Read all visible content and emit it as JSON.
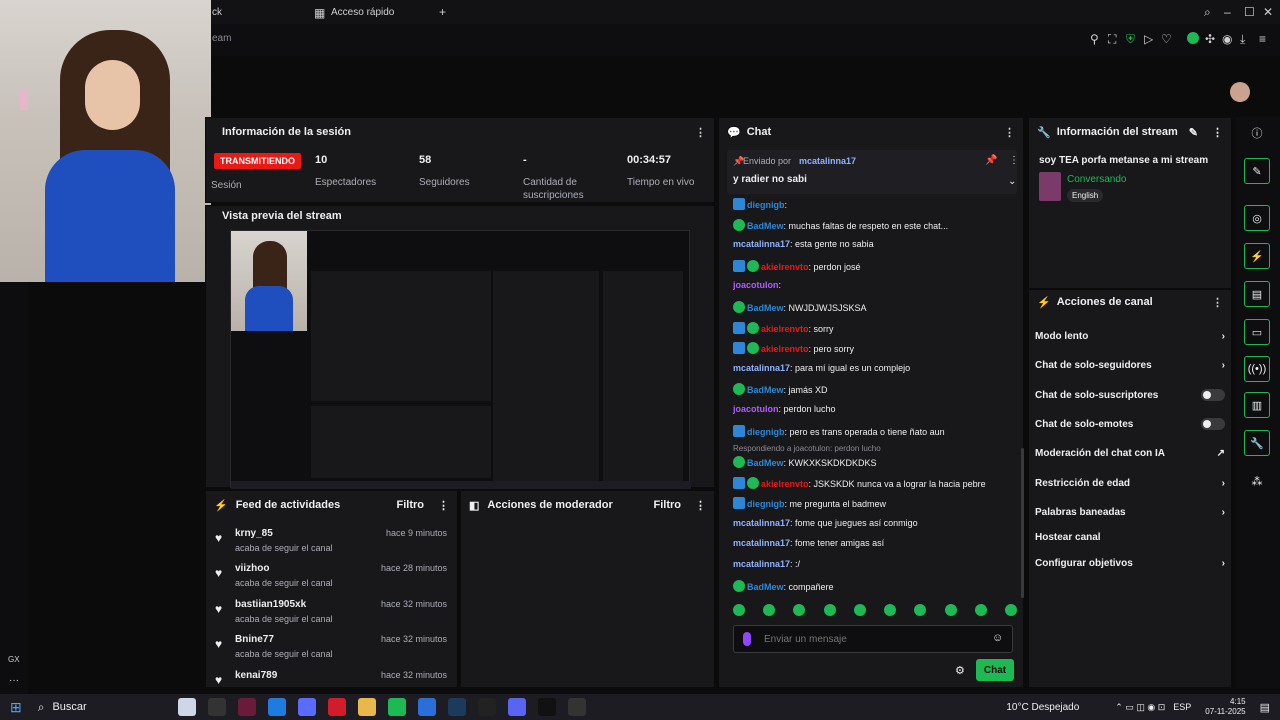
{
  "browser": {
    "tab_partial": "ck",
    "quick_access_tab": "Acceso rápido",
    "address_partial": "eam"
  },
  "gx": {
    "label": "GX"
  },
  "session": {
    "title": "Información de la sesión",
    "live_badge": "TRANSMITIENDO",
    "session_label": "Sesión",
    "viewers_value": "10",
    "viewers_label": "Espectadores",
    "followers_value": "58",
    "followers_label": "Seguidores",
    "subs_value": "-",
    "subs_label": "Cantidad de suscripciones",
    "uptime_value": "00:34:57",
    "uptime_label": "Tiempo en vivo"
  },
  "preview": {
    "title": "Vista previa del stream"
  },
  "feed": {
    "title": "Feed de actividades",
    "filter": "Filtro",
    "items": [
      {
        "name": "krny_85",
        "desc": "acaba de seguir el canal",
        "time": "hace 9 minutos"
      },
      {
        "name": "viizhoo",
        "desc": "acaba de seguir el canal",
        "time": "hace 28 minutos"
      },
      {
        "name": "bastiian1905xk",
        "desc": "acaba de seguir el canal",
        "time": "hace 32 minutos"
      },
      {
        "name": "Bnine77",
        "desc": "acaba de seguir el canal",
        "time": "hace 32 minutos"
      },
      {
        "name": "kenai789",
        "desc": "",
        "time": "hace 32 minutos"
      }
    ]
  },
  "mod": {
    "title": "Acciones de moderador",
    "filter": "Filtro"
  },
  "chat": {
    "title": "Chat",
    "pinned_prefix": "Enviado por",
    "pinned_user": "mcatalinna17",
    "pinned_text": "y radier no sabi",
    "messages": [
      {
        "user": "diegnigb",
        "text": "",
        "color": "#2e87d6",
        "badges": "blue"
      },
      {
        "user": "BadMew",
        "text": "muchas faltas de respeto en este chat...",
        "color": "#2e87d6",
        "badges": "green"
      },
      {
        "user": "mcatalinna17",
        "text": "esta gente no sabia",
        "color": "#8fb3ff",
        "badges": ""
      },
      {
        "user": "akielrenvto",
        "text": "perdon josé",
        "color": "#e91916",
        "badges": "both"
      },
      {
        "user": "joacotulon",
        "text": "",
        "color": "#b15cff",
        "badges": ""
      },
      {
        "user": "BadMew",
        "text": "NWJDJWJSJSKSA",
        "color": "#2e87d6",
        "badges": "green"
      },
      {
        "user": "akielrenvto",
        "text": "sorry",
        "color": "#e91916",
        "badges": "both"
      },
      {
        "user": "akielrenvto",
        "text": "pero sorry",
        "color": "#e91916",
        "badges": "both"
      },
      {
        "user": "mcatalinna17",
        "text": "para mí igual es un complejo",
        "color": "#8fb3ff",
        "badges": ""
      },
      {
        "user": "BadMew",
        "text": "jamás XD",
        "color": "#2e87d6",
        "badges": "green"
      },
      {
        "user": "joacotulon",
        "text": "perdon lucho",
        "color": "#b15cff",
        "badges": ""
      },
      {
        "user": "diegnigb",
        "text": "pero es trans operada o tiene ñato aun",
        "color": "#2e87d6",
        "badges": "blue"
      }
    ],
    "reply_hint": "Respondiendo a joacotulon: perdon lucho",
    "messages2": [
      {
        "user": "BadMew",
        "text": "KWKXKSKDKDKDKS",
        "color": "#2e87d6",
        "badges": "green"
      },
      {
        "user": "akielrenvto",
        "text": "JSKSKDK nunca",
        "text2": "va a lograr la hacia pebre",
        "color": "#e91916",
        "badges": "both"
      },
      {
        "user": "diegnigb",
        "text": "me pregunta el badmew",
        "color": "#2e87d6",
        "badges": "blue"
      },
      {
        "user": "mcatalinna17",
        "text": "fome que juegues así conmigo",
        "color": "#8fb3ff",
        "badges": ""
      },
      {
        "user": "mcatalinna17",
        "text": "fome tener amigas así",
        "color": "#8fb3ff",
        "badges": ""
      },
      {
        "user": "mcatalinna17",
        "text": ":/",
        "color": "#8fb3ff",
        "badges": ""
      },
      {
        "user": "BadMew",
        "text": "compañere",
        "color": "#2e87d6",
        "badges": "green"
      }
    ],
    "input_placeholder": "Enviar un mensaje",
    "send_label": "Chat"
  },
  "stream_info": {
    "title": "Información del stream",
    "stream_title": "soy TEA porfa metanse a mi stream",
    "category": "Conversando",
    "language": "English"
  },
  "channel_actions": {
    "title": "Acciones de canal",
    "items": [
      {
        "label": "Modo lento",
        "control": "chevron"
      },
      {
        "label": "Chat de solo-seguidores",
        "control": "chevron"
      },
      {
        "label": "Chat de solo-suscriptores",
        "control": "toggle"
      },
      {
        "label": "Chat de solo-emotes",
        "control": "toggle"
      },
      {
        "label": "Moderación del chat con IA",
        "control": "external"
      },
      {
        "label": "Restricción de edad",
        "control": "chevron"
      },
      {
        "label": "Palabras baneadas",
        "control": "chevron"
      },
      {
        "label": "Hostear canal",
        "control": "none"
      },
      {
        "label": "Configurar objetivos",
        "control": "chevron"
      }
    ]
  },
  "taskbar": {
    "search_placeholder": "Buscar",
    "weather": "10°C Despejado",
    "lang": "ESP",
    "time": "4:15",
    "date": "07-11-2025"
  },
  "colors": {
    "accent": "#1db954",
    "live": "#e91916",
    "twitch_purple": "#9147ff"
  }
}
